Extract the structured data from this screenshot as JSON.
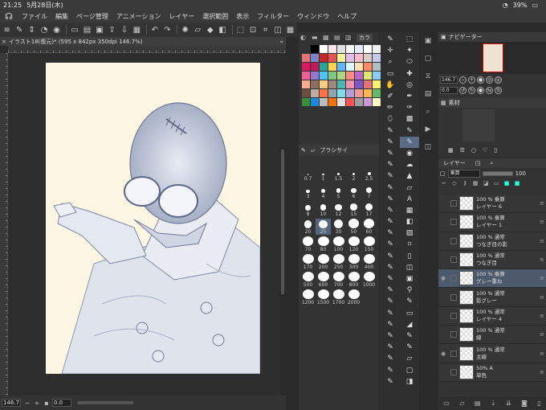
{
  "status": {
    "time": "21:25",
    "date": "5月28日(木)",
    "battery": "39%"
  },
  "menu": [
    "ファイル",
    "編集",
    "ページ管理",
    "アニメーション",
    "レイヤー",
    "選択範囲",
    "表示",
    "フィルター",
    "ウィンドウ",
    "ヘルプ"
  ],
  "document": {
    "tab_title": "イラスト18(復元)* (595 x 842px 350dpi 146.7%)"
  },
  "canvas": {
    "zoom": "146.7",
    "zoom_small": "0.0"
  },
  "palette": {
    "tab_label": "カラ",
    "swatches": [
      "#333333",
      "#000000",
      "#ffffff",
      "#fce4ec",
      "#e0e0e0",
      "#f5f5f5",
      "#e8eaf6",
      "#ffffff",
      "#f0f0f0",
      "#e57373",
      "#7986cb",
      "#c62828",
      "#ef5350",
      "#fff59d",
      "#e1bee7",
      "#f8bbd0",
      "#d7ccc8",
      "#c5cae9",
      "#d81b60",
      "#c2185b",
      "#26a69a",
      "#ffd54f",
      "#64b5f6",
      "#e1f5fe",
      "#ffe0b2",
      "#ff8a65",
      "#b0bec5",
      "#f06292",
      "#9575cd",
      "#4fc3f7",
      "#81c784",
      "#aed581",
      "#ff8a80",
      "#ba68c8",
      "#dce775",
      "#90caf9",
      "#ffab91",
      "#8d6e63",
      "#ffcc80",
      "#a1887f",
      "#4db6ac",
      "#f48fb1",
      "#7e57c2",
      "#e57373",
      "#fff176",
      "#6d4c41",
      "#bcaaa4",
      "#ff7043",
      "#90a4ae",
      "#80deea",
      "#b39ddb",
      "#ef9a9a",
      "#ffb74d",
      "#66bb6a",
      "#388e3c",
      "#1e88e5",
      "#bdbdbd",
      "#ff6f00",
      "#e0e0e0",
      "#ff5252",
      "#9e9e9e",
      "#ce93d8",
      "#fff9c4"
    ],
    "brush_size_tab": "ブラシサイ",
    "brush_sizes": [
      "0.7",
      "1",
      "1.5",
      "2",
      "2.5",
      "3",
      "4",
      "5",
      "6",
      "7",
      "8",
      "10",
      "12",
      "15",
      "17",
      "20",
      "25",
      "30",
      "50",
      "60",
      "70",
      "80",
      "100",
      "120",
      "150",
      "170",
      "200",
      "250",
      "300",
      "400",
      "500",
      "600",
      "700",
      "800",
      "1000",
      "1200",
      "1500",
      "1700",
      "2000"
    ],
    "selected_size": "25"
  },
  "navigator": {
    "title": "ナビゲーター",
    "zoom": "146.7",
    "angle": "0.0"
  },
  "material": {
    "title": "素材"
  },
  "layers": {
    "tab": "レイヤー",
    "blend": "乗算",
    "opacity": "100",
    "items": [
      {
        "mode": "100 % 乗算",
        "name": "レイヤー 6",
        "visible": false,
        "selected": false
      },
      {
        "mode": "100 % 乗算",
        "name": "レイヤー 1",
        "visible": false,
        "selected": false
      },
      {
        "mode": "100 % 通常",
        "name": "つなぎ目の影",
        "visible": false,
        "selected": false
      },
      {
        "mode": "100 % 通常",
        "name": "つなぎ目",
        "visible": false,
        "selected": false
      },
      {
        "mode": "100 % 乗算",
        "name": "グレー重ね",
        "visible": true,
        "selected": true
      },
      {
        "mode": "100 % 通常",
        "name": "影グレー",
        "visible": false,
        "selected": false
      },
      {
        "mode": "100 % 通常",
        "name": "レイヤー 4",
        "visible": false,
        "selected": false
      },
      {
        "mode": "100 % 通常",
        "name": "線",
        "visible": false,
        "selected": false
      },
      {
        "mode": "100 % 通常",
        "name": "主線",
        "visible": true,
        "selected": false
      },
      {
        "mode": "50% A",
        "name": "単色",
        "visible": false,
        "selected": false
      }
    ]
  },
  "colors": {
    "accent": "#5a6b84",
    "bg": "#2b2b2b",
    "paper": "#fdf6e3"
  }
}
